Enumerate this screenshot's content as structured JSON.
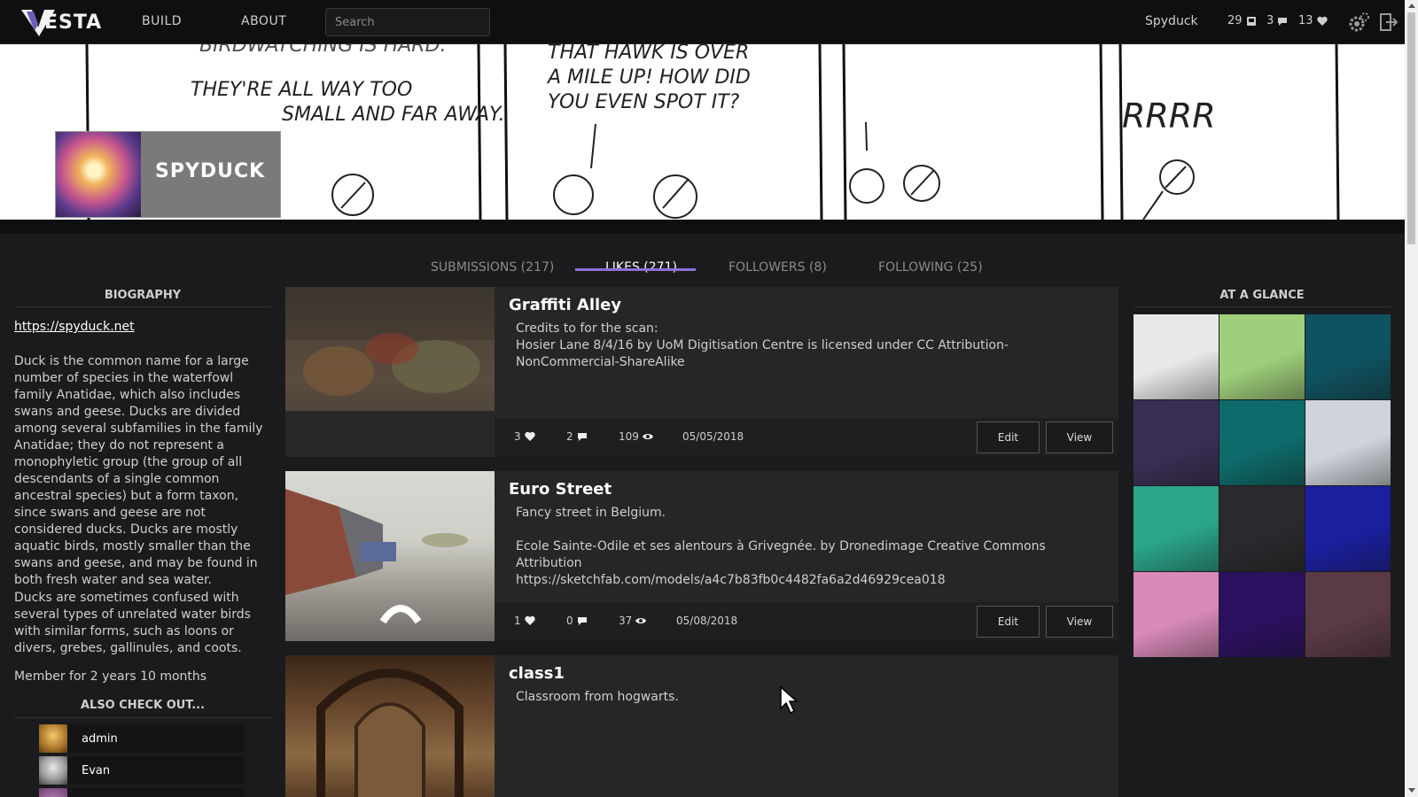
{
  "nav": {
    "logo": "ESTA",
    "links": [
      "BUILD",
      "ABOUT"
    ],
    "search_placeholder": "Search",
    "username": "Spyduck",
    "stats": [
      {
        "value": "29",
        "icon": "image-icon"
      },
      {
        "value": "3",
        "icon": "comment-icon"
      },
      {
        "value": "13",
        "icon": "heart-icon"
      }
    ]
  },
  "profile": {
    "name": "SPYDUCK"
  },
  "tabs": [
    {
      "label": "SUBMISSIONS (217)",
      "active": false
    },
    {
      "label": "LIKES (271)",
      "active": true
    },
    {
      "label": "FOLLOWERS (8)",
      "active": false
    },
    {
      "label": "FOLLOWING (25)",
      "active": false
    }
  ],
  "biography": {
    "heading": "BIOGRAPHY",
    "link": "https://spyduck.net",
    "paragraphs": [
      "Duck is the common name for a large number of species in the waterfowl family Anatidae, which also includes swans and geese. Ducks are divided among several subfamilies in the family Anatidae; they do not represent a monophyletic group (the group of all descendants of a single common ancestral species) but a form taxon, since swans and geese are not considered ducks. Ducks are mostly aquatic birds, mostly smaller than the swans and geese, and may be found in both fresh water and sea water.",
      "Ducks are sometimes confused with several types of unrelated water birds with similar forms, such as loons or divers, grebes, gallinules, and coots."
    ],
    "member_since": "Member for 2 years 10 months"
  },
  "also_check_out": {
    "heading": "ALSO CHECK OUT...",
    "users": [
      "admin",
      "Evan",
      ""
    ]
  },
  "submissions": [
    {
      "title": "Graffiti Alley",
      "description": "Credits to for the scan:\nHosier Lane 8/4/16 by UoM Digitisation Centre is licensed under CC Attribution-NonCommercial-ShareAlike",
      "likes": "3",
      "comments": "2",
      "views": "109",
      "date": "05/05/2018",
      "edit_label": "Edit",
      "view_label": "View"
    },
    {
      "title": "Euro Street",
      "description": "Fancy street in Belgium.\n\nEcole Sainte-Odile et ses alentours à Grivegnée. by Dronedimage Creative Commons Attribution\nhttps://sketchfab.com/models/a4c7b83fb0c4482fa6a2d46929cea018",
      "likes": "1",
      "comments": "0",
      "views": "37",
      "date": "05/08/2018",
      "edit_label": "Edit",
      "view_label": "View"
    },
    {
      "title": "class1",
      "description": "Classroom from hogwarts.",
      "likes": "",
      "comments": "",
      "views": "",
      "date": "",
      "edit_label": "",
      "view_label": ""
    }
  ],
  "at_a_glance": {
    "heading": "AT A GLANCE",
    "thumbs": [
      {
        "color": "#e8e8ea"
      },
      {
        "color": "#9fcf7a"
      },
      {
        "color": "#0f5360"
      },
      {
        "color": "#3b2e55"
      },
      {
        "color": "#0d6b6b"
      },
      {
        "color": "#cfd3da"
      },
      {
        "color": "#2aa58a"
      },
      {
        "color": "#2a2a2e"
      },
      {
        "color": "#1a1fa0"
      },
      {
        "color": "#d98ab9"
      },
      {
        "color": "#2b1060"
      },
      {
        "color": "#5a3a44"
      }
    ]
  },
  "colors": {
    "accent": "#8c6fd8",
    "nav_bg": "#0f0f10",
    "card_bg": "#262628",
    "page_bg": "#1b1b1d"
  }
}
